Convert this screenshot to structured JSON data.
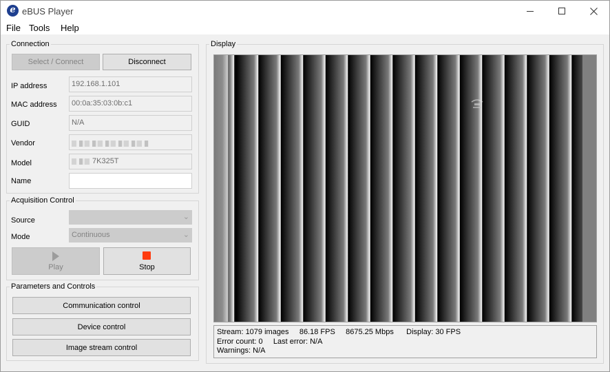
{
  "window": {
    "title": "eBUS Player",
    "icon_letter": "e",
    "controls": [
      "minimize-icon",
      "maximize-icon",
      "close-icon"
    ]
  },
  "menu": [
    "File",
    "Tools",
    "Help"
  ],
  "connection": {
    "legend": "Connection",
    "select_connect_label": "Select / Connect",
    "disconnect_label": "Disconnect",
    "fields": {
      "ip_label": "IP address",
      "ip_value": "192.168.1.101",
      "mac_label": "MAC address",
      "mac_value": "00:0a:35:03:0b:c1",
      "guid_label": "GUID",
      "guid_value": "N/A",
      "vendor_label": "Vendor",
      "vendor_value": "",
      "model_label": "Model",
      "model_value": "7K325T",
      "name_label": "Name",
      "name_value": ""
    }
  },
  "acquisition": {
    "legend": "Acquisition Control",
    "source_label": "Source",
    "source_value": "",
    "mode_label": "Mode",
    "mode_value": "Continuous",
    "play_label": "Play",
    "stop_label": "Stop",
    "stop_color": "#ff3b0f"
  },
  "parameters": {
    "legend": "Parameters and Controls",
    "buttons": [
      "Communication control",
      "Device control",
      "Image stream control"
    ]
  },
  "display": {
    "legend": "Display",
    "stats": {
      "stream": "Stream: 1079 images",
      "fps": "86.18 FPS",
      "bandwidth": "8675.25 Mbps",
      "display_rate": "Display: 30 FPS",
      "error_count": "Error count: 0",
      "last_error": "Last error: N/A",
      "warnings": "Warnings: N/A"
    }
  }
}
